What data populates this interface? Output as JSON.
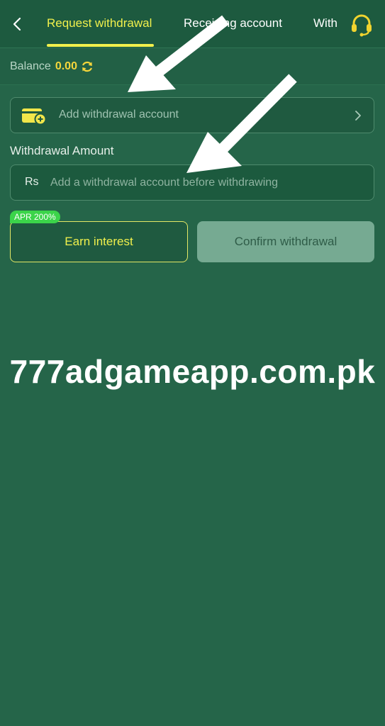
{
  "header": {
    "tabs": [
      {
        "label": "Request withdrawal",
        "active": true
      },
      {
        "label": "Receiving account",
        "active": false
      },
      {
        "label": "With",
        "active": false
      }
    ],
    "back_icon": "chevron-left-icon",
    "support_icon": "headset-icon"
  },
  "balance": {
    "label": "Balance",
    "value": "0.00",
    "refresh_icon": "refresh-icon"
  },
  "account": {
    "label": "Add withdrawal account",
    "icon": "wallet-add-icon"
  },
  "amount": {
    "title": "Withdrawal Amount",
    "currency": "Rs",
    "placeholder": "Add a withdrawal account before withdrawing",
    "value": ""
  },
  "actions": {
    "badge": "APR 200%",
    "earn_label": "Earn interest",
    "confirm_label": "Confirm withdrawal"
  },
  "watermark": "777adgameapp.com.pk",
  "colors": {
    "background": "#256549",
    "accent": "#f1f04c",
    "balance_value": "#f5d63b",
    "badge": "#3bd44a",
    "confirm_disabled": "#76aa92"
  }
}
